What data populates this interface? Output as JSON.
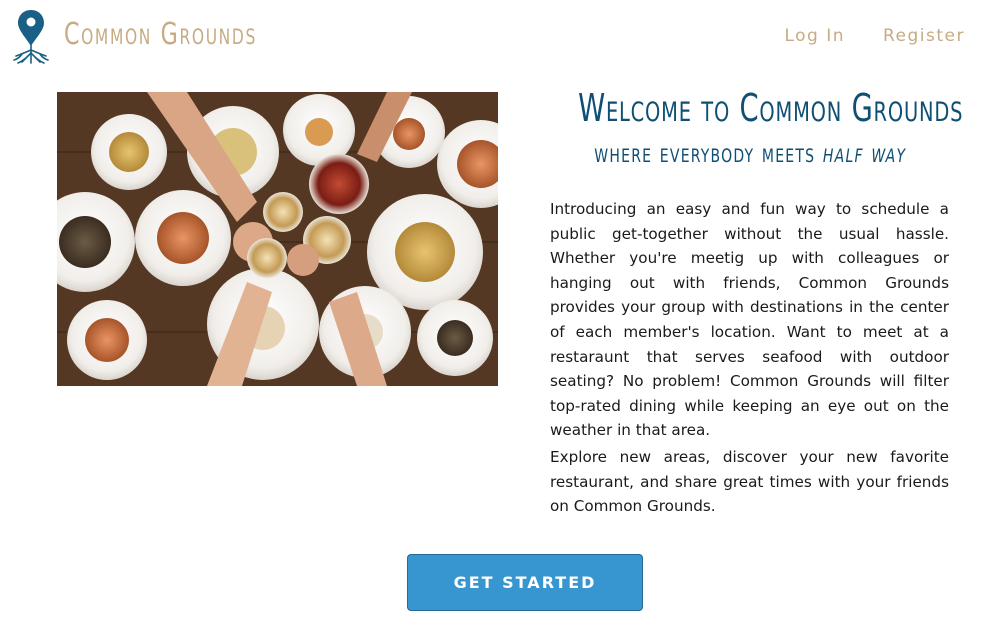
{
  "brand": {
    "name": "Common Grounds"
  },
  "nav": {
    "login_label": "Log In",
    "register_label": "Register"
  },
  "hero": {
    "title": "Welcome to Common Grounds",
    "subtitle_prefix": "where everybody meets",
    "subtitle_emphasis": "half way",
    "paragraph_1": "Introducing an easy and fun way to schedule a public get-together without the usual hassle. Whether you're meetig up with colleagues or hanging out with friends, Common Grounds provides your group with destinations in the center of each member's location. Want to meet at a restaraunt that serves seafood with outdoor seating? No problem! Common Grounds will filter top-rated dining while keeping an eye out on the weather in that area.",
    "paragraph_2": "Explore new areas, discover your new favorite restaurant, and share great times with your friends on Common Grounds.",
    "cta_label": "GET STARTED"
  },
  "colors": {
    "brand_tan": "#c6ab83",
    "title_blue": "#0f4f73",
    "button_blue": "#3796cf",
    "logo_blue": "#1a5f86"
  },
  "icons": {
    "logo": "map-pin-roots-icon"
  }
}
